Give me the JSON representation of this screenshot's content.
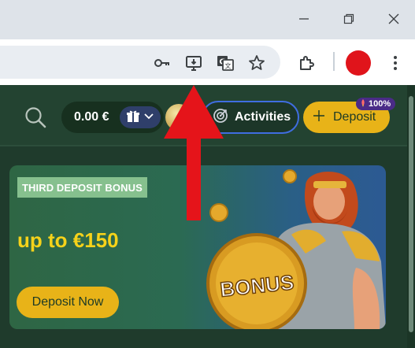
{
  "window": {
    "controls": [
      "minimize-icon",
      "restore-icon",
      "close-icon"
    ]
  },
  "toolbar": {
    "omnibox_icons": [
      "key-icon",
      "install-app-icon",
      "translate-icon",
      "star-icon"
    ],
    "right_icons": [
      "extensions-icon",
      "profile-avatar",
      "more-menu-icon"
    ],
    "profile_color": "#e0141b"
  },
  "header": {
    "balance": "0.00 €",
    "activities_label": "Activities",
    "deposit_label": "Deposit",
    "deposit_badge": "100%"
  },
  "promo": {
    "tag": "THIRD DEPOSIT BONUS",
    "amount": "up to €150",
    "cta_label": "Deposit Now",
    "shield_text": "BONUS"
  },
  "colors": {
    "page_bg": "#1f3b2c",
    "accent_yellow": "#e8b318",
    "activities_border": "#3f6de0",
    "annotation_arrow": "#e5141a"
  }
}
